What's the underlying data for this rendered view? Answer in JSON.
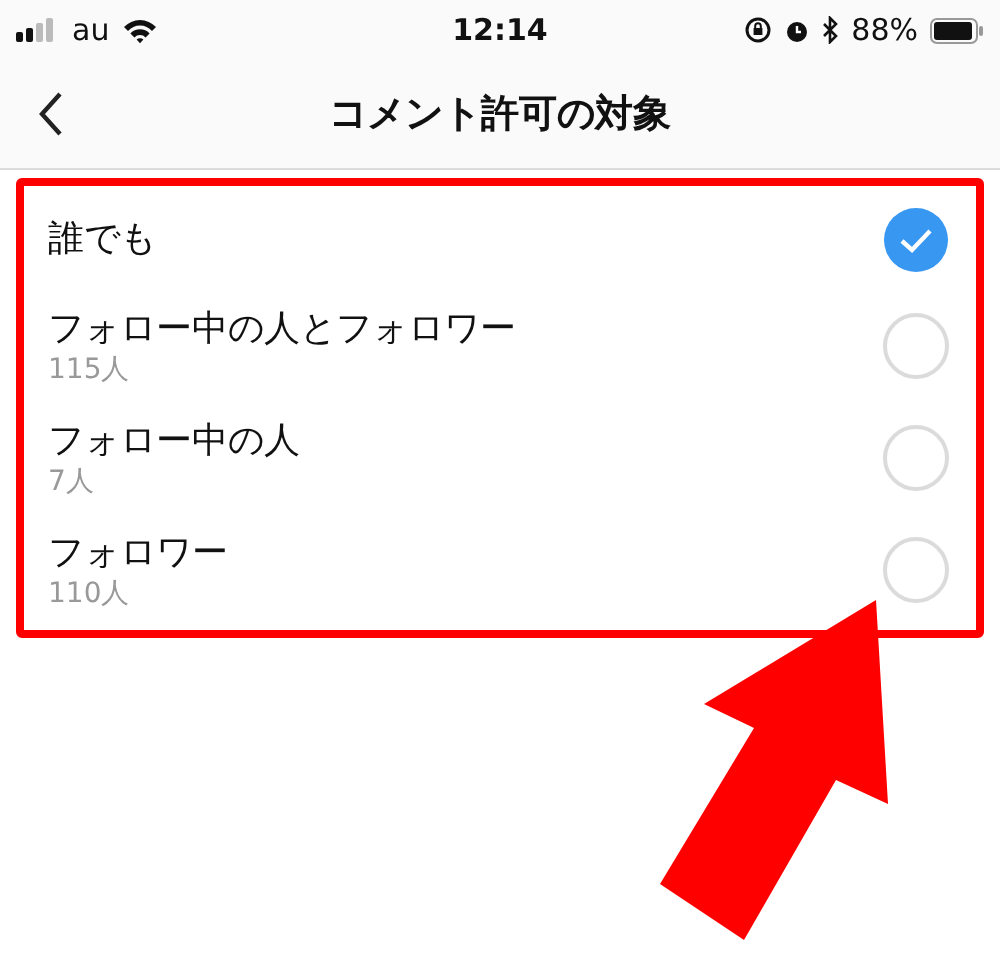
{
  "status_bar": {
    "carrier": "au",
    "time": "12:14",
    "battery": "88%"
  },
  "nav": {
    "title": "コメント許可の対象"
  },
  "options": [
    {
      "label": "誰でも",
      "selected": true
    },
    {
      "label": "フォロー中の人とフォロワー",
      "count": "115人",
      "selected": false
    },
    {
      "label": "フォロー中の人",
      "count": "7人",
      "selected": false
    },
    {
      "label": "フォロワー",
      "count": "110人",
      "selected": false
    }
  ]
}
